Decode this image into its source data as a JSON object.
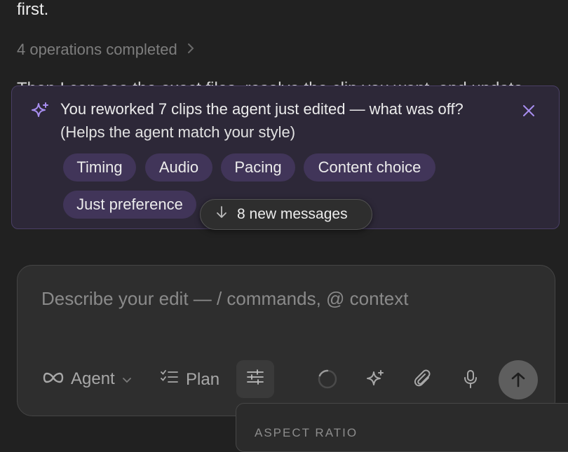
{
  "chat": {
    "prev_text": "first.",
    "operations_label": "4 operations completed",
    "cut_text": "Then I can see the exact files, resolve the clip you want, and update"
  },
  "feedback": {
    "title": "You reworked 7 clips the agent just edited — what was off?",
    "subtitle": "(Helps the agent match your style)",
    "chips": [
      "Timing",
      "Audio",
      "Pacing",
      "Content choice",
      "Just preference"
    ]
  },
  "new_messages": {
    "label": "8 new messages"
  },
  "composer": {
    "placeholder": "Describe your edit —  /  commands,  @  context",
    "agent_label": "Agent",
    "plan_label": "Plan"
  },
  "popover": {
    "aspect_label": "ASPECT RATIO"
  },
  "colors": {
    "accent": "#a88ef0",
    "chip_bg": "#413559",
    "panel_bg": "#2d2838"
  }
}
